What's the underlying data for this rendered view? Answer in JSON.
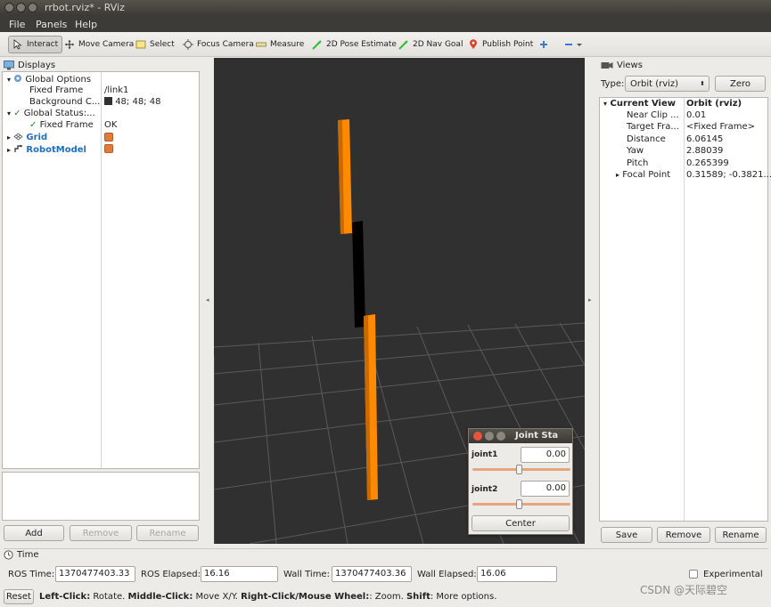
{
  "window": {
    "title": "rrbot.rviz* - RViz"
  },
  "menu": [
    "File",
    "Panels",
    "Help"
  ],
  "toolbar": {
    "tools": [
      "Interact",
      "Move Camera",
      "Select",
      "Focus Camera",
      "Measure",
      "2D Pose Estimate",
      "2D Nav Goal",
      "Publish Point"
    ],
    "active": "Interact"
  },
  "displays": {
    "title": "Displays",
    "rows": {
      "global_options": "Global Options",
      "fixed_frame_label": "Fixed Frame",
      "fixed_frame_value": "/link1",
      "background_label": "Background C...",
      "background_value": "48; 48; 48",
      "global_status": "Global Status:...",
      "status_fixed_frame_label": "Fixed Frame",
      "status_fixed_frame_value": "OK",
      "grid": "Grid",
      "robot_model": "RobotModel"
    },
    "buttons": {
      "add": "Add",
      "remove": "Remove",
      "rename": "Rename"
    }
  },
  "views": {
    "title": "Views",
    "type_label": "Type:",
    "type_value": "Orbit (rviz)",
    "zero": "Zero",
    "current_view_label": "Current View",
    "current_view_value": "Orbit (rviz)",
    "props": [
      {
        "name": "Near Clip ...",
        "value": "0.01"
      },
      {
        "name": "Target Fra...",
        "value": "<Fixed Frame>"
      },
      {
        "name": "Distance",
        "value": "6.06145"
      },
      {
        "name": "Yaw",
        "value": "2.88039"
      },
      {
        "name": "Pitch",
        "value": "0.265399"
      },
      {
        "name": "Focal Point",
        "value": "0.31589; -0.3821..."
      }
    ],
    "buttons": {
      "save": "Save",
      "remove": "Remove",
      "rename": "Rename"
    }
  },
  "joint_panel": {
    "title": "Joint Sta",
    "joint1_label": "joint1",
    "joint1_value": "0.00",
    "joint2_label": "joint2",
    "joint2_value": "0.00",
    "center": "Center"
  },
  "time": {
    "title": "Time",
    "ros_time_label": "ROS Time:",
    "ros_time": "1370477403.33",
    "ros_elapsed_label": "ROS Elapsed:",
    "ros_elapsed": "16.16",
    "wall_time_label": "Wall Time:",
    "wall_time": "1370477403.36",
    "wall_elapsed_label": "Wall Elapsed:",
    "wall_elapsed": "16.06",
    "experimental": "Experimental"
  },
  "status": {
    "reset": "Reset",
    "left_click_key": "Left-Click:",
    "left_click_text": " Rotate. ",
    "middle_click_key": "Middle-Click:",
    "middle_click_text": " Move X/Y. ",
    "right_click_key": "Right-Click/Mouse Wheel:",
    "right_click_text": ": Zoom. ",
    "shift_key": "Shift",
    "shift_text": ": More options."
  },
  "watermark": "CSDN @天际碧空",
  "colors": {
    "viewport_bg": "#303030",
    "link_orange": "#ff8a00",
    "link_black": "#000000",
    "tree_blue": "#1d6fc0"
  }
}
